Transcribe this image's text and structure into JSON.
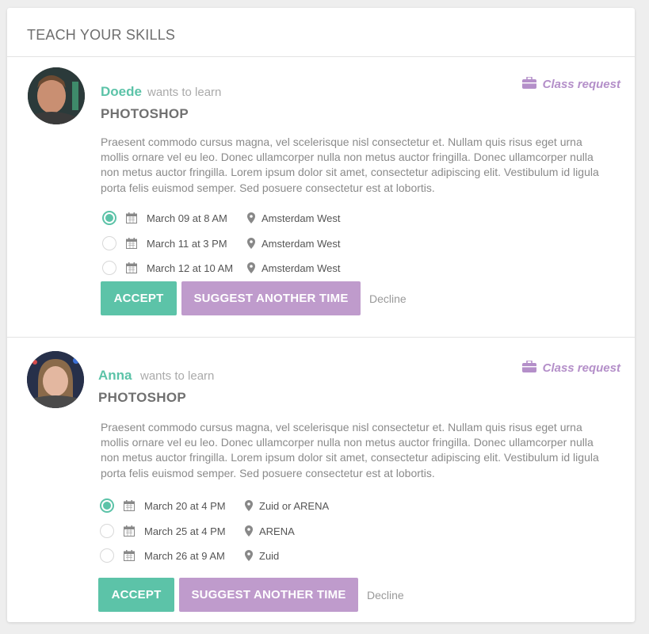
{
  "header": {
    "title": "TEACH YOUR SKILLS"
  },
  "colors": {
    "accent": "#5cc3a8",
    "purple": "#bf9bcc",
    "tag": "#b48fc9"
  },
  "requests": [
    {
      "name": "Doede",
      "wants": "wants to learn",
      "topic": "PHOTOSHOP",
      "tag": "Class request",
      "tag_icon": "briefcase-icon",
      "description": "Praesent commodo cursus magna, vel scelerisque nisl consectetur et. Nullam quis risus eget urna mollis ornare vel eu leo. Donec ullamcorper nulla non metus auctor fringilla. Donec ullamcorper nulla non metus auctor fringilla. Lorem ipsum dolor sit amet, consectetur adipiscing elit. Vestibulum id ligula porta felis euismod semper. Sed posuere consectetur est at lobortis.",
      "slots": [
        {
          "date": "March 09 at 8 AM",
          "location": "Amsterdam West",
          "selected": true
        },
        {
          "date": "March 11 at 3 PM",
          "location": "Amsterdam West",
          "selected": false
        },
        {
          "date": "March 12 at 10 AM",
          "location": "Amsterdam West",
          "selected": false
        }
      ],
      "accept_label": "ACCEPT",
      "suggest_label": "SUGGEST ANOTHER TIME",
      "decline_label": "Decline"
    },
    {
      "name": "Anna",
      "wants": "wants to learn",
      "topic": "PHOTOSHOP",
      "tag": "Class request",
      "tag_icon": "briefcase-icon",
      "description": "Praesent commodo cursus magna, vel scelerisque nisl consectetur et. Nullam quis risus eget urna mollis ornare vel eu leo. Donec ullamcorper nulla non metus auctor fringilla. Donec ullamcorper nulla non metus auctor fringilla. Lorem ipsum dolor sit amet, consectetur adipiscing elit. Vestibulum id ligula porta felis euismod semper. Sed posuere consectetur est at lobortis.",
      "slots": [
        {
          "date": "March 20 at 4 PM",
          "location": "Zuid or ARENA",
          "selected": true
        },
        {
          "date": "March 25 at 4 PM",
          "location": "ARENA",
          "selected": false
        },
        {
          "date": "March 26 at 9 AM",
          "location": "Zuid",
          "selected": false
        }
      ],
      "accept_label": "ACCEPT",
      "suggest_label": "SUGGEST ANOTHER TIME",
      "decline_label": "Decline"
    }
  ]
}
